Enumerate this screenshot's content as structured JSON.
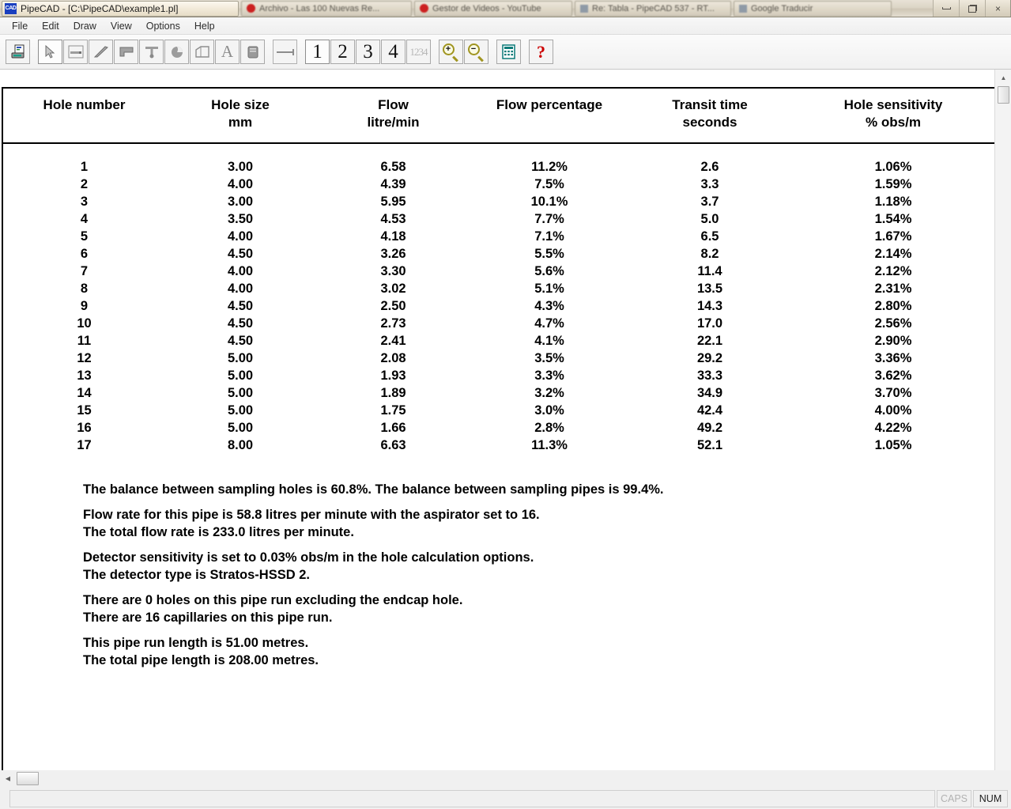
{
  "os_taskbar": {
    "active_window_title": "PipeCAD - [C:\\PipeCAD\\example1.pl]",
    "app_icon": "cad-icon",
    "items": [
      {
        "label": "Archivo - Las 100 Nuevas Re...",
        "icon": "record-icon"
      },
      {
        "label": "Gestor de Videos - YouTube",
        "icon": "record-icon"
      },
      {
        "label": "Re: Tabla - PipeCAD 537 - RT...",
        "icon": "window-icon"
      },
      {
        "label": "Google Traducir",
        "icon": "window-icon"
      }
    ],
    "window_controls": {
      "minimize": "minimize-icon",
      "restore": "restore-icon",
      "close": "×"
    }
  },
  "menubar": {
    "items": [
      "File",
      "Edit",
      "Draw",
      "View",
      "Options",
      "Help"
    ]
  },
  "toolbar": {
    "buttons": [
      {
        "name": "print-preview-button",
        "glyph": ""
      },
      {
        "name": "select-tool-button",
        "glyph": ""
      },
      {
        "name": "pipe-tool-button",
        "glyph": ""
      },
      {
        "name": "line-tool-button",
        "glyph": ""
      },
      {
        "name": "bend-tool-button",
        "glyph": ""
      },
      {
        "name": "tee-tool-button",
        "glyph": ""
      },
      {
        "name": "endcap-tool-button",
        "glyph": ""
      },
      {
        "name": "room-tool-button",
        "glyph": ""
      },
      {
        "name": "text-tool-button",
        "glyph": "A"
      },
      {
        "name": "detector-tool-button",
        "glyph": ""
      },
      {
        "name": "ruler-tool-button",
        "glyph": ""
      },
      {
        "name": "pipe-1-button",
        "glyph": "1"
      },
      {
        "name": "pipe-2-button",
        "glyph": "2"
      },
      {
        "name": "pipe-3-button",
        "glyph": "3"
      },
      {
        "name": "pipe-4-button",
        "glyph": "4"
      },
      {
        "name": "all-pipes-button",
        "glyph": "1234"
      },
      {
        "name": "zoom-in-button",
        "glyph": "+"
      },
      {
        "name": "zoom-out-button",
        "glyph": "−"
      },
      {
        "name": "calculate-button",
        "glyph": "calculator"
      },
      {
        "name": "help-button",
        "glyph": "?"
      }
    ],
    "active_button": "pipe-1-button"
  },
  "report": {
    "columns": [
      {
        "title": "Hole number",
        "unit": ""
      },
      {
        "title": "Hole size",
        "unit": "mm"
      },
      {
        "title": "Flow",
        "unit": "litre/min"
      },
      {
        "title": "Flow percentage",
        "unit": ""
      },
      {
        "title": "Transit time",
        "unit": "seconds"
      },
      {
        "title": "Hole sensitivity",
        "unit": "% obs/m"
      }
    ],
    "rows": [
      {
        "hole": "1",
        "size": "3.00",
        "flow": "6.58",
        "pct": "11.2%",
        "transit": "2.6",
        "sens": "1.06%"
      },
      {
        "hole": "2",
        "size": "4.00",
        "flow": "4.39",
        "pct": "7.5%",
        "transit": "3.3",
        "sens": "1.59%"
      },
      {
        "hole": "3",
        "size": "3.00",
        "flow": "5.95",
        "pct": "10.1%",
        "transit": "3.7",
        "sens": "1.18%"
      },
      {
        "hole": "4",
        "size": "3.50",
        "flow": "4.53",
        "pct": "7.7%",
        "transit": "5.0",
        "sens": "1.54%"
      },
      {
        "hole": "5",
        "size": "4.00",
        "flow": "4.18",
        "pct": "7.1%",
        "transit": "6.5",
        "sens": "1.67%"
      },
      {
        "hole": "6",
        "size": "4.50",
        "flow": "3.26",
        "pct": "5.5%",
        "transit": "8.2",
        "sens": "2.14%"
      },
      {
        "hole": "7",
        "size": "4.00",
        "flow": "3.30",
        "pct": "5.6%",
        "transit": "11.4",
        "sens": "2.12%"
      },
      {
        "hole": "8",
        "size": "4.00",
        "flow": "3.02",
        "pct": "5.1%",
        "transit": "13.5",
        "sens": "2.31%"
      },
      {
        "hole": "9",
        "size": "4.50",
        "flow": "2.50",
        "pct": "4.3%",
        "transit": "14.3",
        "sens": "2.80%"
      },
      {
        "hole": "10",
        "size": "4.50",
        "flow": "2.73",
        "pct": "4.7%",
        "transit": "17.0",
        "sens": "2.56%"
      },
      {
        "hole": "11",
        "size": "4.50",
        "flow": "2.41",
        "pct": "4.1%",
        "transit": "22.1",
        "sens": "2.90%"
      },
      {
        "hole": "12",
        "size": "5.00",
        "flow": "2.08",
        "pct": "3.5%",
        "transit": "29.2",
        "sens": "3.36%"
      },
      {
        "hole": "13",
        "size": "5.00",
        "flow": "1.93",
        "pct": "3.3%",
        "transit": "33.3",
        "sens": "3.62%"
      },
      {
        "hole": "14",
        "size": "5.00",
        "flow": "1.89",
        "pct": "3.2%",
        "transit": "34.9",
        "sens": "3.70%"
      },
      {
        "hole": "15",
        "size": "5.00",
        "flow": "1.75",
        "pct": "3.0%",
        "transit": "42.4",
        "sens": "4.00%"
      },
      {
        "hole": "16",
        "size": "5.00",
        "flow": "1.66",
        "pct": "2.8%",
        "transit": "49.2",
        "sens": "4.22%"
      },
      {
        "hole": "17",
        "size": "8.00",
        "flow": "6.63",
        "pct": "11.3%",
        "transit": "52.1",
        "sens": "1.05%"
      }
    ],
    "notes": {
      "balance": "The balance between sampling holes is 60.8%. The balance between sampling pipes is 99.4%.",
      "flow_rate_pipe": "Flow rate for this pipe is 58.8 litres per minute with the aspirator set to 16.",
      "flow_rate_total": "The total flow rate is 233.0 litres per minute.",
      "detector_sensitivity": "Detector sensitivity is set to 0.03% obs/m in the hole calculation options.",
      "detector_type": "The detector type is Stratos-HSSD 2.",
      "holes_count": "There are 0 holes on this pipe run excluding the endcap hole.",
      "capillaries_count": "There are 16 capillaries on this pipe run.",
      "pipe_run_length": "This pipe run length is 51.00 metres.",
      "total_pipe_length": "The total pipe length is 208.00 metres."
    }
  },
  "statusbar": {
    "message": "",
    "caps": "CAPS",
    "num": "NUM"
  },
  "colors": {
    "hole_size_green": "#108010",
    "help_red": "#cc0000",
    "text_black": "#000000"
  }
}
